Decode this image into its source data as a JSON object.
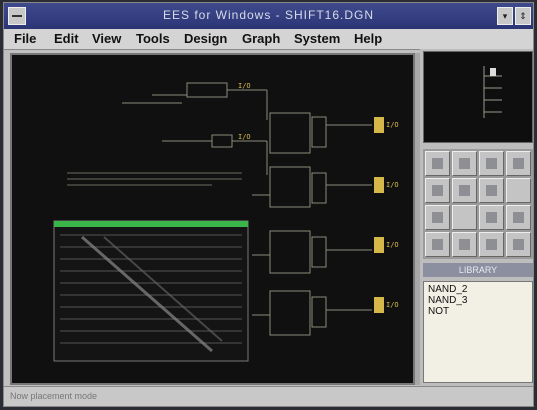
{
  "window": {
    "title": "EES for Windows - SHIFT16.DGN",
    "controls": {
      "minimize": "▾",
      "restore": "⇕"
    }
  },
  "menu": {
    "items": [
      "File",
      "Edit",
      "View",
      "Tools",
      "Design",
      "Graph",
      "System",
      "Help"
    ]
  },
  "canvas": {
    "labels": [
      "I/O",
      "I/O",
      "I/O",
      "I/O",
      "I/O",
      "I/O"
    ]
  },
  "library": {
    "title": "LIBRARY",
    "items": [
      "NAND_2",
      "NAND_3",
      "NOT"
    ]
  },
  "status": {
    "text": "Now placement mode"
  },
  "colors": {
    "canvas_bg": "#0f100f",
    "titlebar": "#2b3576",
    "probe_label": "#d6b84a",
    "waveform_bar": "#3ab54a"
  }
}
